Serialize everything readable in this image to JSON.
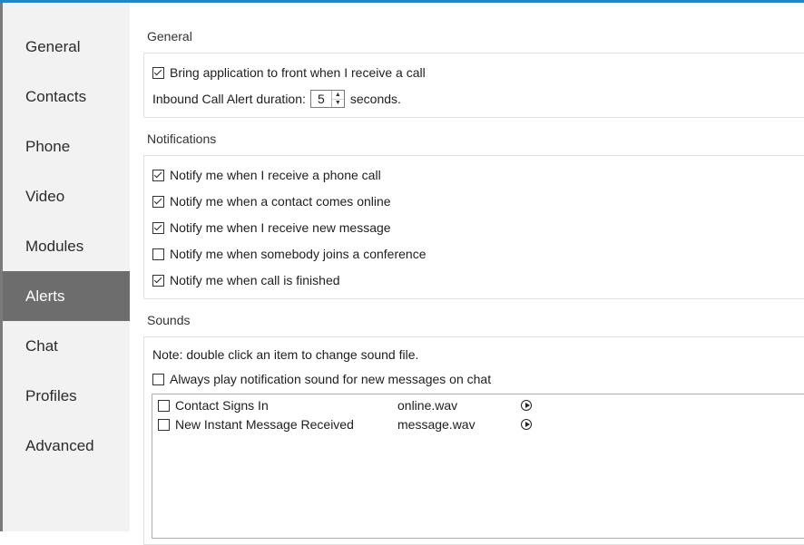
{
  "sidebar": {
    "items": [
      {
        "label": "General"
      },
      {
        "label": "Contacts"
      },
      {
        "label": "Phone"
      },
      {
        "label": "Video"
      },
      {
        "label": "Modules"
      },
      {
        "label": "Alerts",
        "active": true
      },
      {
        "label": "Chat"
      },
      {
        "label": "Profiles"
      },
      {
        "label": "Advanced"
      }
    ]
  },
  "general": {
    "title": "General",
    "bring_front_label": "Bring application to front when I receive a call",
    "bring_front_checked": true,
    "alert_duration_label": "Inbound Call Alert duration:",
    "alert_duration_value": "5",
    "alert_duration_unit": "seconds."
  },
  "notifications": {
    "title": "Notifications",
    "items": [
      {
        "label": "Notify me when I receive a phone call",
        "checked": true
      },
      {
        "label": "Notify me when a contact comes online",
        "checked": true
      },
      {
        "label": "Notify me when I receive new message",
        "checked": true
      },
      {
        "label": "Notify me when somebody joins a conference",
        "checked": false
      },
      {
        "label": "Notify me when call is finished",
        "checked": true
      }
    ]
  },
  "sounds": {
    "title": "Sounds",
    "note": "Note: double click an item to change sound file.",
    "always_play_label": "Always play notification sound for new messages on chat",
    "always_play_checked": false,
    "list": [
      {
        "name": "Contact Signs In",
        "file": "online.wav",
        "checked": false
      },
      {
        "name": "New Instant Message Received",
        "file": "message.wav",
        "checked": false
      }
    ]
  },
  "colors": {
    "accent": "#1e87c9",
    "sidebar_bg": "#f2f2f2",
    "sidebar_active": "#6d6d6d"
  }
}
